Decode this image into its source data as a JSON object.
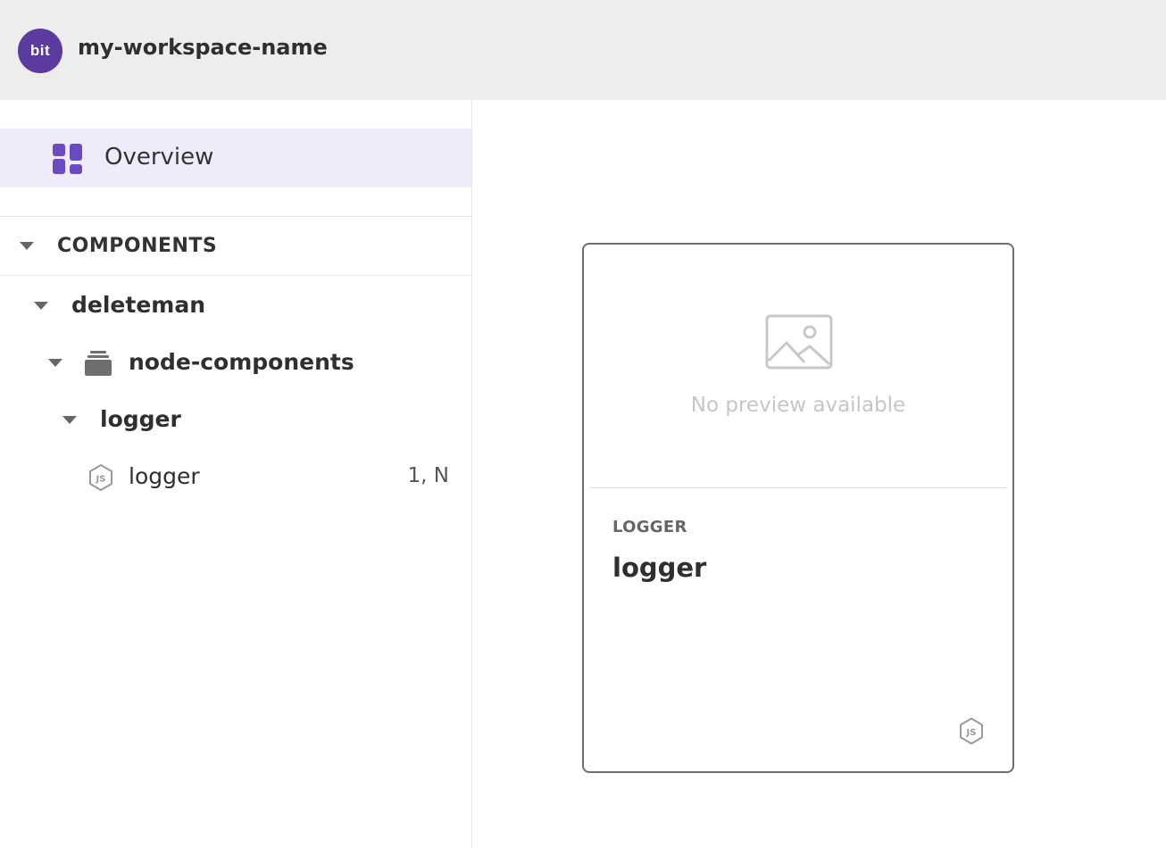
{
  "header": {
    "logo_text": "bit",
    "workspace_name": "my-workspace-name",
    "logo_color": "#5b3b9e"
  },
  "sidebar": {
    "overview": {
      "label": "Overview",
      "icon": "dashboard-grid-icon",
      "active": true,
      "highlight_color": "#eeebfb",
      "icon_color": "#6c4bc1"
    },
    "components_section": {
      "label": "COMPONENTS",
      "expanded": true
    },
    "tree": {
      "scope": {
        "label": "deleteman",
        "expanded": true
      },
      "namespace": {
        "label": "node-components",
        "icon": "folder-stack-icon",
        "expanded": true
      },
      "component_folder": {
        "label": "logger",
        "expanded": true
      },
      "component": {
        "label": "logger",
        "icon": "nodejs-icon",
        "status": "1, N"
      }
    }
  },
  "card": {
    "preview_icon": "image-placeholder-icon",
    "no_preview_text": "No preview available",
    "scope_label": "LOGGER",
    "name": "logger",
    "env_icon": "nodejs-icon"
  }
}
